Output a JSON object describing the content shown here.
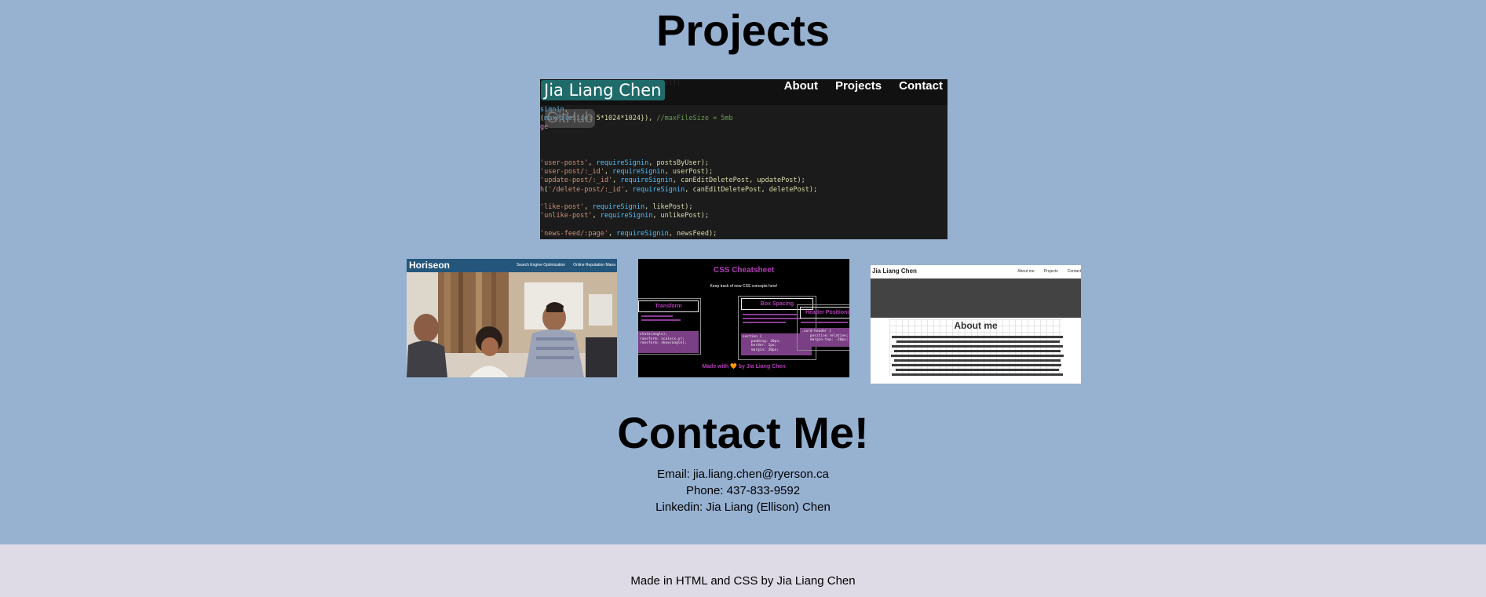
{
  "projects_title": "Projects",
  "featured": {
    "logo": "Jia Liang Chen",
    "nav": [
      "About",
      "Projects",
      "Contact"
    ],
    "overlay": "GitHub"
  },
  "thumbnails": {
    "horiseon": {
      "brand": "Horiseon",
      "links": [
        "Search Engine Optimization",
        "Online Reputation Mana"
      ]
    },
    "cheatsheet": {
      "title": "CSS Cheatsheet",
      "subtitle": "Keep track of new CSS concepts here!",
      "cards": [
        "Transform",
        "Box Spacing",
        "Header Positioning"
      ],
      "footer": "Made with 🧡 by Jia Liang Chen"
    },
    "portfolio": {
      "brand": "Jia Liang Chen",
      "nav": [
        "About me",
        "Projects",
        "Contact"
      ],
      "heading": "About me"
    }
  },
  "contact": {
    "title": "Contact Me!",
    "email": "Email: jia.liang.chen@ryerson.ca",
    "phone": "Phone: 437-833-9592",
    "linkedin": "Linkedin: Jia Liang (Ellison) Chen"
  },
  "footer": {
    "text": "Made in HTML and CSS by Jia Liang Chen"
  },
  "colors": {
    "page_background": "#97b1d1",
    "footer_background": "#dedbe6",
    "logo_teal": "#1e6b6a",
    "cheatsheet_purple": "#b13db6"
  }
}
